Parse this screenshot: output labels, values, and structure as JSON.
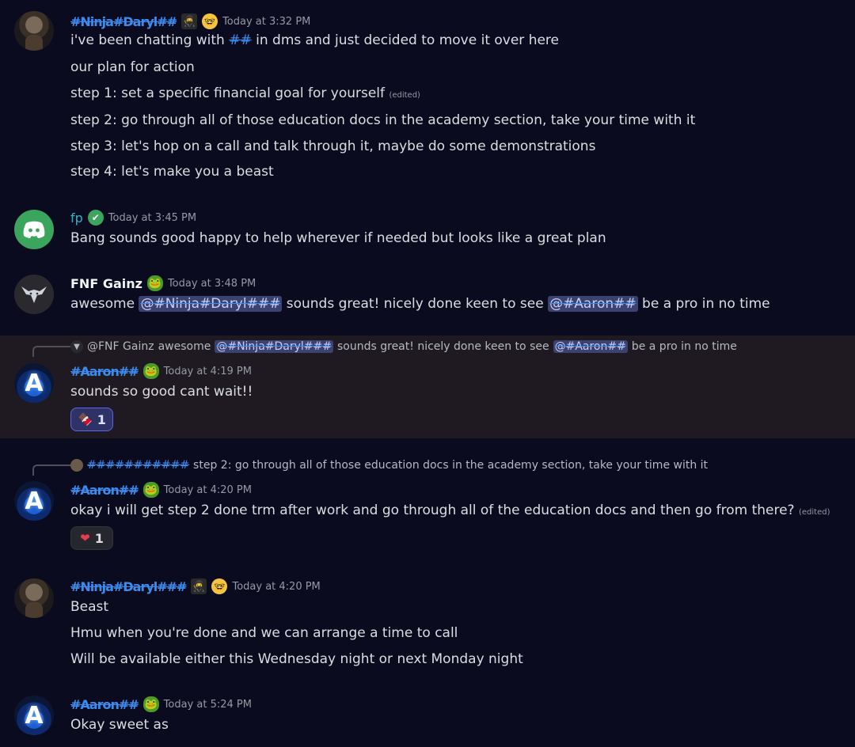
{
  "messages": [
    {
      "author": "#Ninja#Daryl##",
      "time": "Today at 3:32 PM",
      "lines": [
        {
          "before": "i've been chatting with ",
          "mention": "##",
          "after": " in dms and just decided to move it over here"
        },
        {
          "text": "our plan for action"
        },
        {
          "text": "step 1: set a specific financial goal for yourself",
          "edited": "(edited)"
        },
        {
          "text": "step 2: go through all of those education docs in the academy section, take your time with it"
        },
        {
          "text": "step 3: let's hop on a call and talk through it, maybe do some demonstrations"
        },
        {
          "text": "step 4: let's make you a beast"
        }
      ]
    },
    {
      "author": "fp",
      "time": "Today at 3:45 PM",
      "lines": [
        {
          "text": "Bang sounds good happy to help wherever if needed but looks like a great plan"
        }
      ]
    },
    {
      "author": "FNF Gainz",
      "time": "Today at 3:48 PM",
      "line": {
        "before": "awesome ",
        "mention1": "@#Ninja#Daryl###",
        "middle": " sounds great! nicely done keen to see ",
        "mention2": "@#Aaron##",
        "after": " be a pro in no time"
      }
    },
    {
      "reply": {
        "author": "@FNF Gainz",
        "before": " awesome ",
        "mention1": "@#Ninja#Daryl###",
        "middle": " sounds great! nicely done keen to see ",
        "mention2": "@#Aaron##",
        "after": " be a pro in no time"
      },
      "author": "#Aaron##",
      "time": "Today at 4:19 PM",
      "text": "sounds so good cant wait!!",
      "reaction": {
        "emoji": "🍫",
        "count": "1"
      }
    },
    {
      "reply": {
        "author": "###########",
        "text": "step 2: go through all of those education docs in the academy section, take your time with it"
      },
      "author": "#Aaron##",
      "time": "Today at 4:20 PM",
      "text": "okay i will get step 2 done trm after work and go  through all of the education docs and then go from there?",
      "edited": "(edited)",
      "reaction": {
        "emoji": "❤",
        "count": "1"
      }
    },
    {
      "author": "#Ninja#Daryl###",
      "time": "Today at 4:20 PM",
      "lines": [
        {
          "text": "Beast"
        },
        {
          "text": "Hmu when you're done and we can arrange a time to call"
        },
        {
          "text": "Will be available either this Wednesday night or next Monday night"
        }
      ]
    },
    {
      "author": "#Aaron##",
      "time": "Today at 5:24 PM",
      "text": "Okay sweet as"
    }
  ],
  "icons": {
    "nerd": "nerd-face-emoji",
    "ninja": "ninja-emoji",
    "frog": "pepe-frog-emoji",
    "verified": "verified-check-icon"
  },
  "colors": {
    "background": "#0b0b1f",
    "mention_bg": "#3c4270",
    "redaction": "#3b8cf0",
    "highlight_row": "#1f1a22",
    "reaction_active": "#5865f2"
  }
}
